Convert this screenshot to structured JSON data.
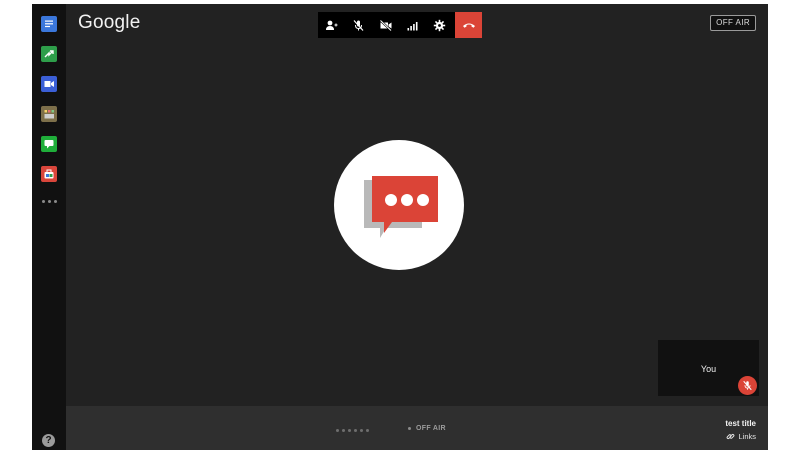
{
  "header": {
    "logo_text": "Google",
    "broadcast_status": "OFF AIR"
  },
  "toolbar": {
    "buttons": [
      {
        "icon": "add-person-icon"
      },
      {
        "icon": "mic-off-icon"
      },
      {
        "icon": "camera-off-icon"
      },
      {
        "icon": "signal-bars-icon"
      },
      {
        "icon": "gear-icon"
      },
      {
        "icon": "hang-up-icon",
        "color": "#db4437"
      }
    ]
  },
  "sidebar": {
    "apps": [
      {
        "icon": "chat-app-icon",
        "color": "#3b77db"
      },
      {
        "icon": "screenshare-app-icon",
        "color": "#2e9e4a"
      },
      {
        "icon": "video-app-icon",
        "color": "#3b5fd6"
      },
      {
        "icon": "control-room-app-icon",
        "color": "#7d6f4a"
      },
      {
        "icon": "hangout-chat-app-icon",
        "color": "#1fae3a"
      },
      {
        "icon": "toolbox-app-icon",
        "color": "#d9463b"
      }
    ],
    "more_icon": "more-dots-icon",
    "help_label": "?"
  },
  "stage": {
    "placeholder_icon": "hangouts-chat-bubble-icon",
    "accent_color": "#db4437"
  },
  "self_view": {
    "label": "You",
    "muted_icon": "mic-off-icon"
  },
  "footer": {
    "onair_state": "OFF AIR",
    "broadcast_title": "test title",
    "links_label": "Links"
  }
}
